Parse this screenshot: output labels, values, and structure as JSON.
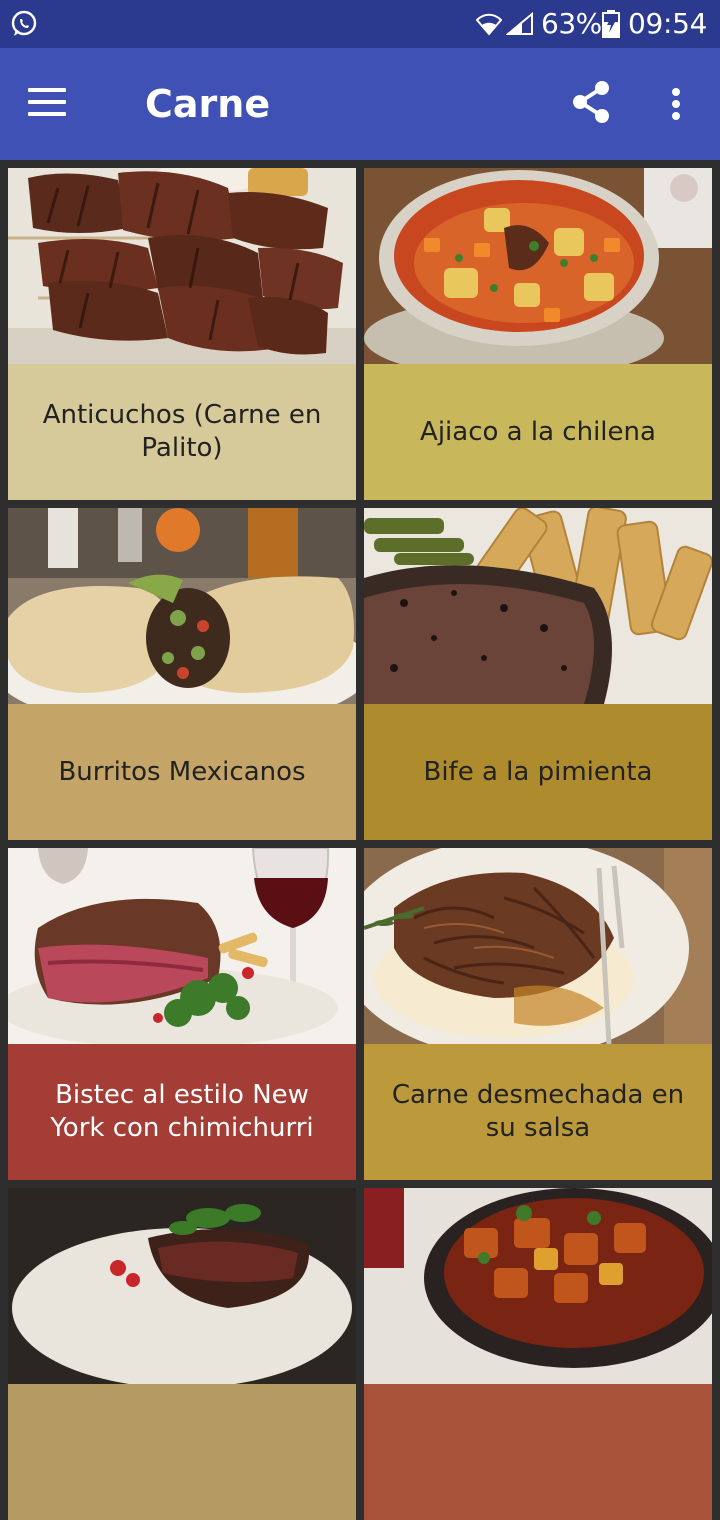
{
  "status_bar": {
    "battery": "63%",
    "time": "09:54",
    "icons": [
      "whatsapp-icon",
      "wifi-icon",
      "signal-icon",
      "battery-charging-icon"
    ]
  },
  "app_bar": {
    "title": "Carne",
    "icons": [
      "menu-icon",
      "share-icon",
      "more-vert-icon"
    ]
  },
  "recipes": [
    {
      "name": "Anticuchos (Carne en Palito)",
      "label_color": "#d6c99a",
      "text_color": "#222222"
    },
    {
      "name": "Ajiaco a la chilena",
      "label_color": "#c9b85b",
      "text_color": "#222222"
    },
    {
      "name": "Burritos Mexicanos",
      "label_color": "#c4a467",
      "text_color": "#222222"
    },
    {
      "name": "Bife a la pimienta",
      "label_color": "#ae8b2c",
      "text_color": "#222222"
    },
    {
      "name": "Bistec al estilo New York con chimichurri",
      "label_color": "#a33d35",
      "text_color": "#ffffff"
    },
    {
      "name": "Carne desmechada en su salsa",
      "label_color": "#bc9a3c",
      "text_color": "#222222"
    },
    {
      "name": "",
      "label_color": "#b59a62",
      "text_color": "#222222"
    },
    {
      "name": "",
      "label_color": "#a8523a",
      "text_color": "#ffffff"
    }
  ]
}
